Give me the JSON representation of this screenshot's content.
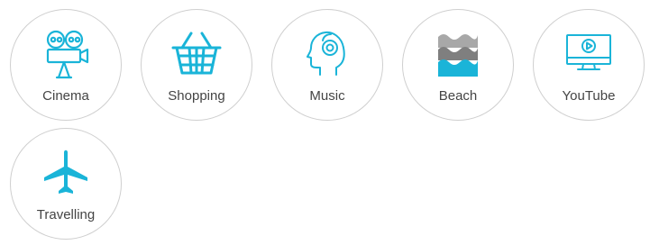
{
  "categories": [
    {
      "label": "Cinema",
      "icon": "cinema-camera-icon"
    },
    {
      "label": "Shopping",
      "icon": "shopping-basket-icon"
    },
    {
      "label": "Music",
      "icon": "music-head-icon"
    },
    {
      "label": "Beach",
      "icon": "beach-waves-icon"
    },
    {
      "label": "YouTube",
      "icon": "video-monitor-icon"
    },
    {
      "label": "Travelling",
      "icon": "airplane-icon"
    }
  ],
  "colors": {
    "accent": "#1ab4d8",
    "text": "#444444",
    "border": "#cfcfcf",
    "wave_gray": "#9a9a9a"
  }
}
